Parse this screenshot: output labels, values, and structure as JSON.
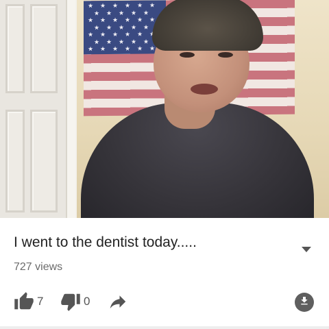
{
  "video": {
    "title": "I went to the dentist today.....",
    "views": "727 views"
  },
  "actions": {
    "like_count": "7",
    "dislike_count": "0"
  },
  "icons": {
    "like": "thumbs-up-icon",
    "dislike": "thumbs-down-icon",
    "share": "share-arrow-icon",
    "download": "download-icon",
    "expand": "chevron-down-icon"
  },
  "colors": {
    "icon": "#555555",
    "title_text": "#222222",
    "secondary_text": "#6b6b6b"
  }
}
